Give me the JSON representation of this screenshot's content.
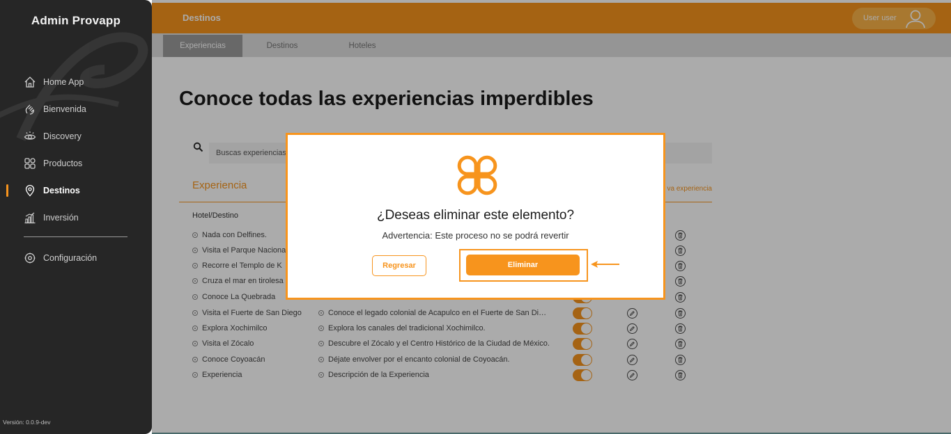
{
  "app": {
    "brand": "Admin Provapp",
    "version": "Versión: 0.0.9-dev"
  },
  "sidebar": {
    "items": [
      {
        "label": "Home App",
        "icon": "home-icon"
      },
      {
        "label": "Bienvenida",
        "icon": "wave-icon"
      },
      {
        "label": "Discovery",
        "icon": "eye-icon"
      },
      {
        "label": "Productos",
        "icon": "grid-icon"
      },
      {
        "label": "Destinos",
        "icon": "location-pin-icon",
        "active": true
      },
      {
        "label": "Inversión",
        "icon": "bar-chart-icon"
      }
    ],
    "settings": {
      "label": "Configuración",
      "icon": "gear-icon"
    }
  },
  "header": {
    "title": "Destinos",
    "user": "User user"
  },
  "tabs": [
    {
      "label": "Experiencias",
      "active": true
    },
    {
      "label": "Destinos"
    },
    {
      "label": "Hoteles"
    }
  ],
  "main": {
    "title": "Conoce todas las experiencias imperdibles",
    "search_placeholder": "Buscas experiencias",
    "section_title": "Experiencia",
    "new_link": "va experiencia",
    "column_hotel": "Hotel/Destino"
  },
  "rows": [
    {
      "name": "Nada con Delfines.",
      "desc": ""
    },
    {
      "name": "Visita el Parque Naciona",
      "desc": ""
    },
    {
      "name": "Recorre el Templo de K",
      "desc": ""
    },
    {
      "name": "Cruza el mar en tirolesa",
      "desc": ""
    },
    {
      "name": "Conoce La Quebrada",
      "desc": ""
    },
    {
      "name": "Visita el Fuerte de San Diego",
      "desc": "Conoce el legado colonial de Acapulco en el Fuerte de San Diego."
    },
    {
      "name": "Explora Xochimilco",
      "desc": "Explora los canales del tradicional Xochimilco."
    },
    {
      "name": "Visita el Zócalo",
      "desc": "Descubre el Zócalo y el Centro Histórico de la Ciudad de México."
    },
    {
      "name": "Conoce Coyoacán",
      "desc": "Déjate envolver por el encanto colonial de Coyoacán."
    },
    {
      "name": "Experiencia",
      "desc": "Descripción de la Experiencia"
    }
  ],
  "modal": {
    "title": "¿Deseas eliminar este elemento?",
    "warning": "Advertencia: Este proceso no se podrá revertir",
    "back_label": "Regresar",
    "delete_label": "Eliminar"
  },
  "colors": {
    "accent": "#f7941d",
    "sidebar": "#262626"
  }
}
